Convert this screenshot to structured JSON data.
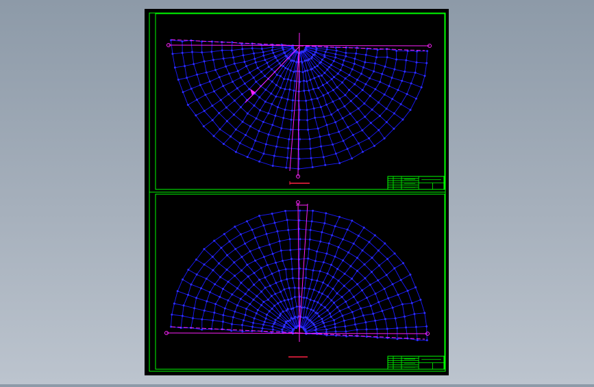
{
  "viewer": {
    "background_top": "#8d9aa8",
    "background_bottom": "#bcc4ce"
  },
  "colors": {
    "paper": "#000000",
    "frame": "#00ff00",
    "mesh": "#1a1aff",
    "node": "#2f2fff",
    "construction": "#ff22ff",
    "dimension": "#ff2244",
    "titleblock": "#00ff00"
  },
  "drawing": {
    "sheets": [
      {
        "id": "top",
        "orientation": "bowl-down"
      },
      {
        "id": "bottom",
        "orientation": "dome-up"
      }
    ],
    "mesh": {
      "radial_segments": 30,
      "rings": 12
    },
    "title_block": {
      "rows": 6,
      "text_lines": [
        "",
        "",
        "",
        "",
        "",
        ""
      ]
    }
  }
}
